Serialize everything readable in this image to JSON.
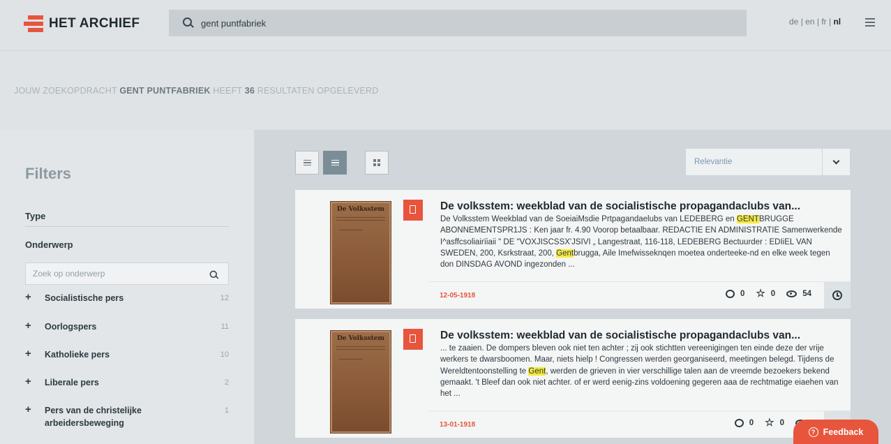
{
  "header": {
    "logo_text": "HET ARCHIEF",
    "search_value": "gent puntfabriek",
    "languages": [
      "de",
      "en",
      "fr",
      "nl"
    ],
    "active_language": "nl"
  },
  "query": {
    "prefix": "JOUW ZOEKOPDRACHT",
    "term": "GENT PUNTFABRIEK",
    "middle": "HEEFT",
    "count": "36",
    "suffix": "RESULTATEN OPGELEVERD"
  },
  "sidebar": {
    "title": "Filters",
    "type_label": "Type",
    "subject_label": "Onderwerp",
    "subject_placeholder": "Zoek op onderwerp",
    "facets": [
      {
        "label": "Socialistische pers",
        "count": "12"
      },
      {
        "label": "Oorlogspers",
        "count": "11"
      },
      {
        "label": "Katholieke pers",
        "count": "10"
      },
      {
        "label": "Liberale pers",
        "count": "2"
      },
      {
        "label": "Pers van de christelijke arbeidersbeweging",
        "count": "1"
      }
    ]
  },
  "main": {
    "sort_value": "Relevantie",
    "results": [
      {
        "thumb_title": "De Volksstem",
        "title": "De volksstem: weekblad van de socialistische propagandaclubs van...",
        "snippet_parts": [
          "De Volksstem Weekblad van de SoeiaiMsdie Prtpagandaelubs van LEDEBERG en ",
          "GENT",
          "BRUGGE ABONNEMENTSPR1JS : Ken jaar fr. 4.90 Voorop betaalbaar. REDACTIE EN ADMINISTRATIE Samenwerkende I^asffcsoliairïiaii \" DE \"VOXJISCSSX'JSIVI „ Langestraat, 116-118, LEDEBERG Bectuurder : EDIiEL VAN SWEDEN, 200, Ksrkstraat, 200, ",
          "Gent",
          "brugga, Aile Imefwisseknqen moetea onderteeke-nd en elke week tegen don DINSDAG AVOND ingezonden ..."
        ],
        "date": "12-05-1918",
        "comments": "0",
        "favorites": "0",
        "views": "54"
      },
      {
        "thumb_title": "De Volksstem",
        "title": "De volksstem: weekblad van de socialistische propagandaclubs van...",
        "snippet_parts": [
          "... te zaaien. De dompers bleven ook niet ten achter ; zij ook stichtten vereenigingen ten einde deze der vrije werkers te dwarsboomen. Maar, niets hielp ! Congressen werden georganiseerd, meetingen belegd. Tijdens de Wereldtentoonstelling te ",
          "Gent",
          ", werden de grieven in vier verschillige talen aan de vreemde bezoekers bekend gemaakt. 't Bleef dan ook niet achter. of er werd eenig-zins voldoening gegeren aaa de rechtmatige eiaehen van het ...",
          "",
          ""
        ],
        "date": "13-01-1918",
        "comments": "0",
        "favorites": "0",
        "views": ""
      }
    ]
  },
  "feedback_label": "Feedback",
  "colors": {
    "accent": "#e8553d",
    "highlight": "#f7e93d",
    "sort_text": "#7b97ad"
  }
}
